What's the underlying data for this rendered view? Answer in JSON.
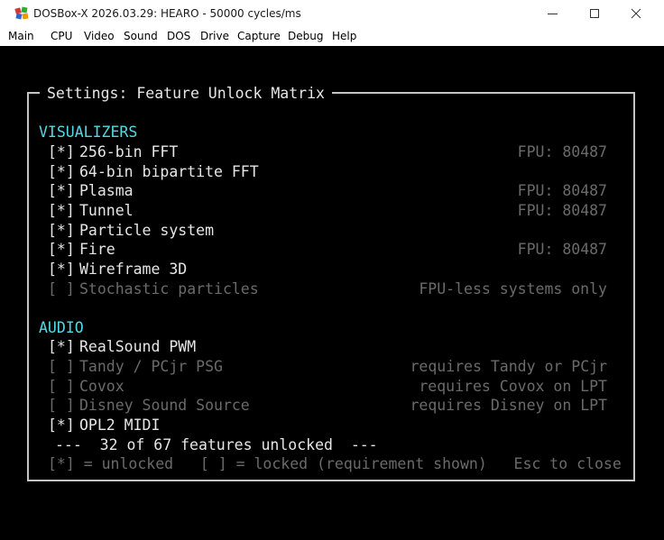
{
  "window": {
    "title": "DOSBox-X 2026.03.29: HEARO - 50000 cycles/ms",
    "icon": "dosbox-icon"
  },
  "menu": [
    "Main",
    "CPU",
    "Video",
    "Sound",
    "DOS",
    "Drive",
    "Capture",
    "Debug",
    "Help"
  ],
  "dialog": {
    "title": "Settings: Feature Unlock Matrix",
    "sections": [
      {
        "heading": "VISUALIZERS",
        "items": [
          {
            "mark": "[*]",
            "label": "256-bin FFT",
            "note": "FPU: 80487",
            "unlocked": true
          },
          {
            "mark": "[*]",
            "label": "64-bin bipartite FFT",
            "note": "",
            "unlocked": true
          },
          {
            "mark": "[*]",
            "label": "Plasma",
            "note": "FPU: 80487",
            "unlocked": true
          },
          {
            "mark": "[*]",
            "label": "Tunnel",
            "note": "FPU: 80487",
            "unlocked": true
          },
          {
            "mark": "[*]",
            "label": "Particle system",
            "note": "",
            "unlocked": true
          },
          {
            "mark": "[*]",
            "label": "Fire",
            "note": "FPU: 80487",
            "unlocked": true
          },
          {
            "mark": "[*]",
            "label": "Wireframe 3D",
            "note": "",
            "unlocked": true
          },
          {
            "mark": "[ ]",
            "label": "Stochastic particles",
            "note": "FPU-less systems only",
            "unlocked": false
          }
        ]
      },
      {
        "heading": "AUDIO",
        "items": [
          {
            "mark": "[*]",
            "label": "RealSound PWM",
            "note": "",
            "unlocked": true
          },
          {
            "mark": "[ ]",
            "label": "Tandy / PCjr PSG",
            "note": "requires Tandy or PCjr",
            "unlocked": false
          },
          {
            "mark": "[ ]",
            "label": "Covox",
            "note": "requires Covox on LPT",
            "unlocked": false
          },
          {
            "mark": "[ ]",
            "label": "Disney Sound Source",
            "note": "requires Disney on LPT",
            "unlocked": false
          },
          {
            "mark": "[*]",
            "label": "OPL2 MIDI",
            "note": "",
            "unlocked": true
          }
        ]
      }
    ],
    "summary": "---  32 of 67 features unlocked  ---",
    "legend": "[*] = unlocked   [ ] = locked (requirement shown)   Esc to close"
  }
}
